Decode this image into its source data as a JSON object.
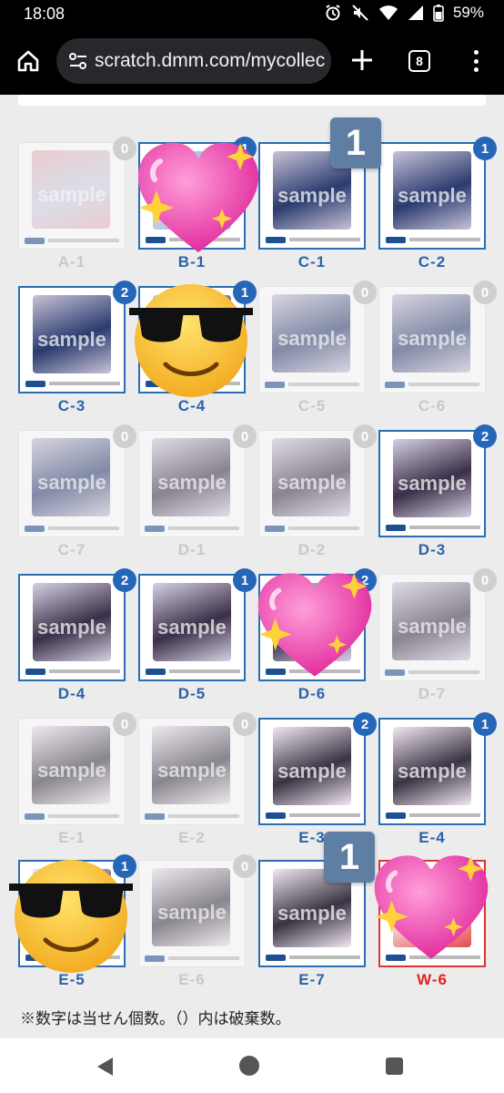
{
  "status": {
    "time": "18:08",
    "battery": "59%",
    "icons": [
      "alarm-icon",
      "mute-icon",
      "wifi-icon",
      "signal-icon",
      "battery-icon"
    ]
  },
  "browser": {
    "url": "scratch.dmm.com/mycollec",
    "tab_count": "8",
    "icons": [
      "home-icon",
      "site-settings-icon",
      "new-tab-icon",
      "tab-switcher-icon",
      "more-menu-icon"
    ]
  },
  "watermark": "sample",
  "cards": [
    {
      "label": "A-1",
      "count": "0",
      "owned": false
    },
    {
      "label": "B-1",
      "count": "1",
      "owned": true
    },
    {
      "label": "C-1",
      "count": "",
      "owned": true
    },
    {
      "label": "C-2",
      "count": "1",
      "owned": true
    },
    {
      "label": "C-3",
      "count": "2",
      "owned": true
    },
    {
      "label": "C-4",
      "count": "1",
      "owned": true
    },
    {
      "label": "C-5",
      "count": "0",
      "owned": false
    },
    {
      "label": "C-6",
      "count": "0",
      "owned": false
    },
    {
      "label": "C-7",
      "count": "0",
      "owned": false
    },
    {
      "label": "D-1",
      "count": "0",
      "owned": false
    },
    {
      "label": "D-2",
      "count": "0",
      "owned": false
    },
    {
      "label": "D-3",
      "count": "2",
      "owned": true
    },
    {
      "label": "D-4",
      "count": "2",
      "owned": true
    },
    {
      "label": "D-5",
      "count": "1",
      "owned": true
    },
    {
      "label": "D-6",
      "count": "2",
      "owned": true
    },
    {
      "label": "D-7",
      "count": "0",
      "owned": false
    },
    {
      "label": "E-1",
      "count": "0",
      "owned": false
    },
    {
      "label": "E-2",
      "count": "0",
      "owned": false
    },
    {
      "label": "E-3",
      "count": "2",
      "owned": true
    },
    {
      "label": "E-4",
      "count": "1",
      "owned": true
    },
    {
      "label": "E-5",
      "count": "1",
      "owned": true
    },
    {
      "label": "E-6",
      "count": "0",
      "owned": false
    },
    {
      "label": "E-7",
      "count": "",
      "owned": true
    },
    {
      "label": "W-6",
      "count": "",
      "owned": true
    }
  ],
  "overlays": {
    "big_badge_1": "1",
    "big_badge_2": "1"
  },
  "footnote": "※数字は当せん個数。（）内は破棄数。",
  "colors": {
    "accent": "#2566b8",
    "badge_off": "#cfcfcf",
    "label_red": "#d22222"
  }
}
